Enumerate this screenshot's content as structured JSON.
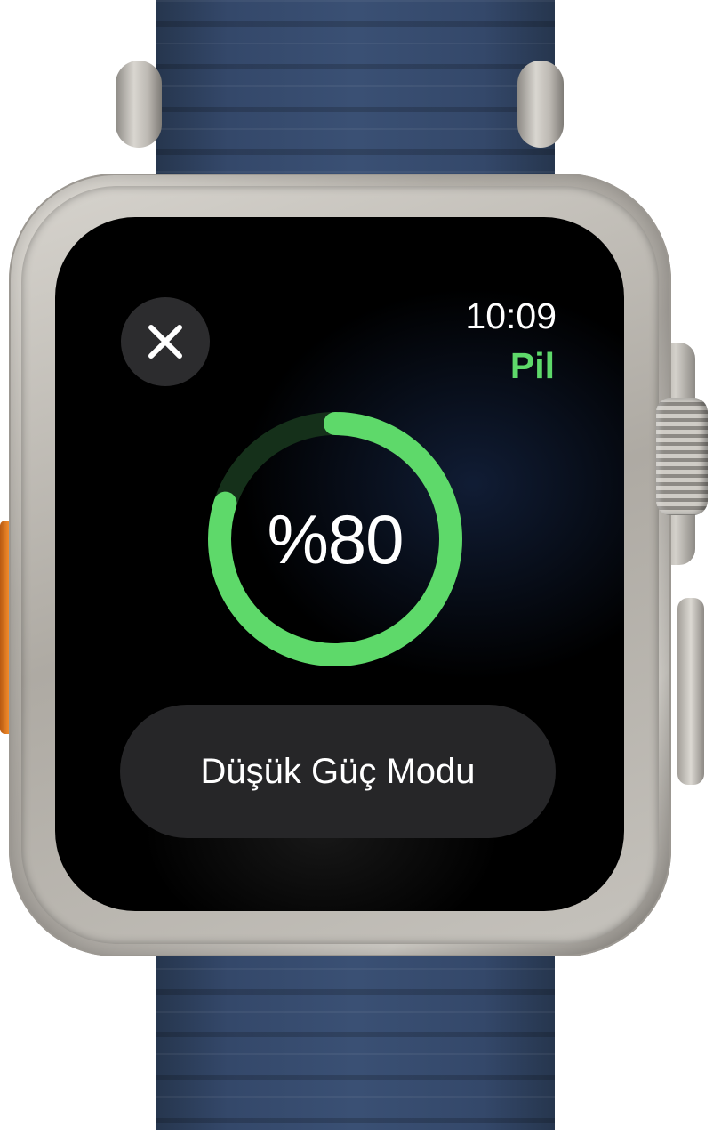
{
  "status": {
    "time": "10:09",
    "app_title": "Pil"
  },
  "battery": {
    "percent_label": "%80",
    "level": 0.8
  },
  "actions": {
    "close_icon": "close-icon",
    "low_power_label": "Düşük Güç Modu"
  },
  "colors": {
    "accent_green": "#5ed96a",
    "ring_track": "#15301a",
    "button_background": "#262628",
    "band": "#34486a",
    "action_button": "#f08a2a"
  }
}
